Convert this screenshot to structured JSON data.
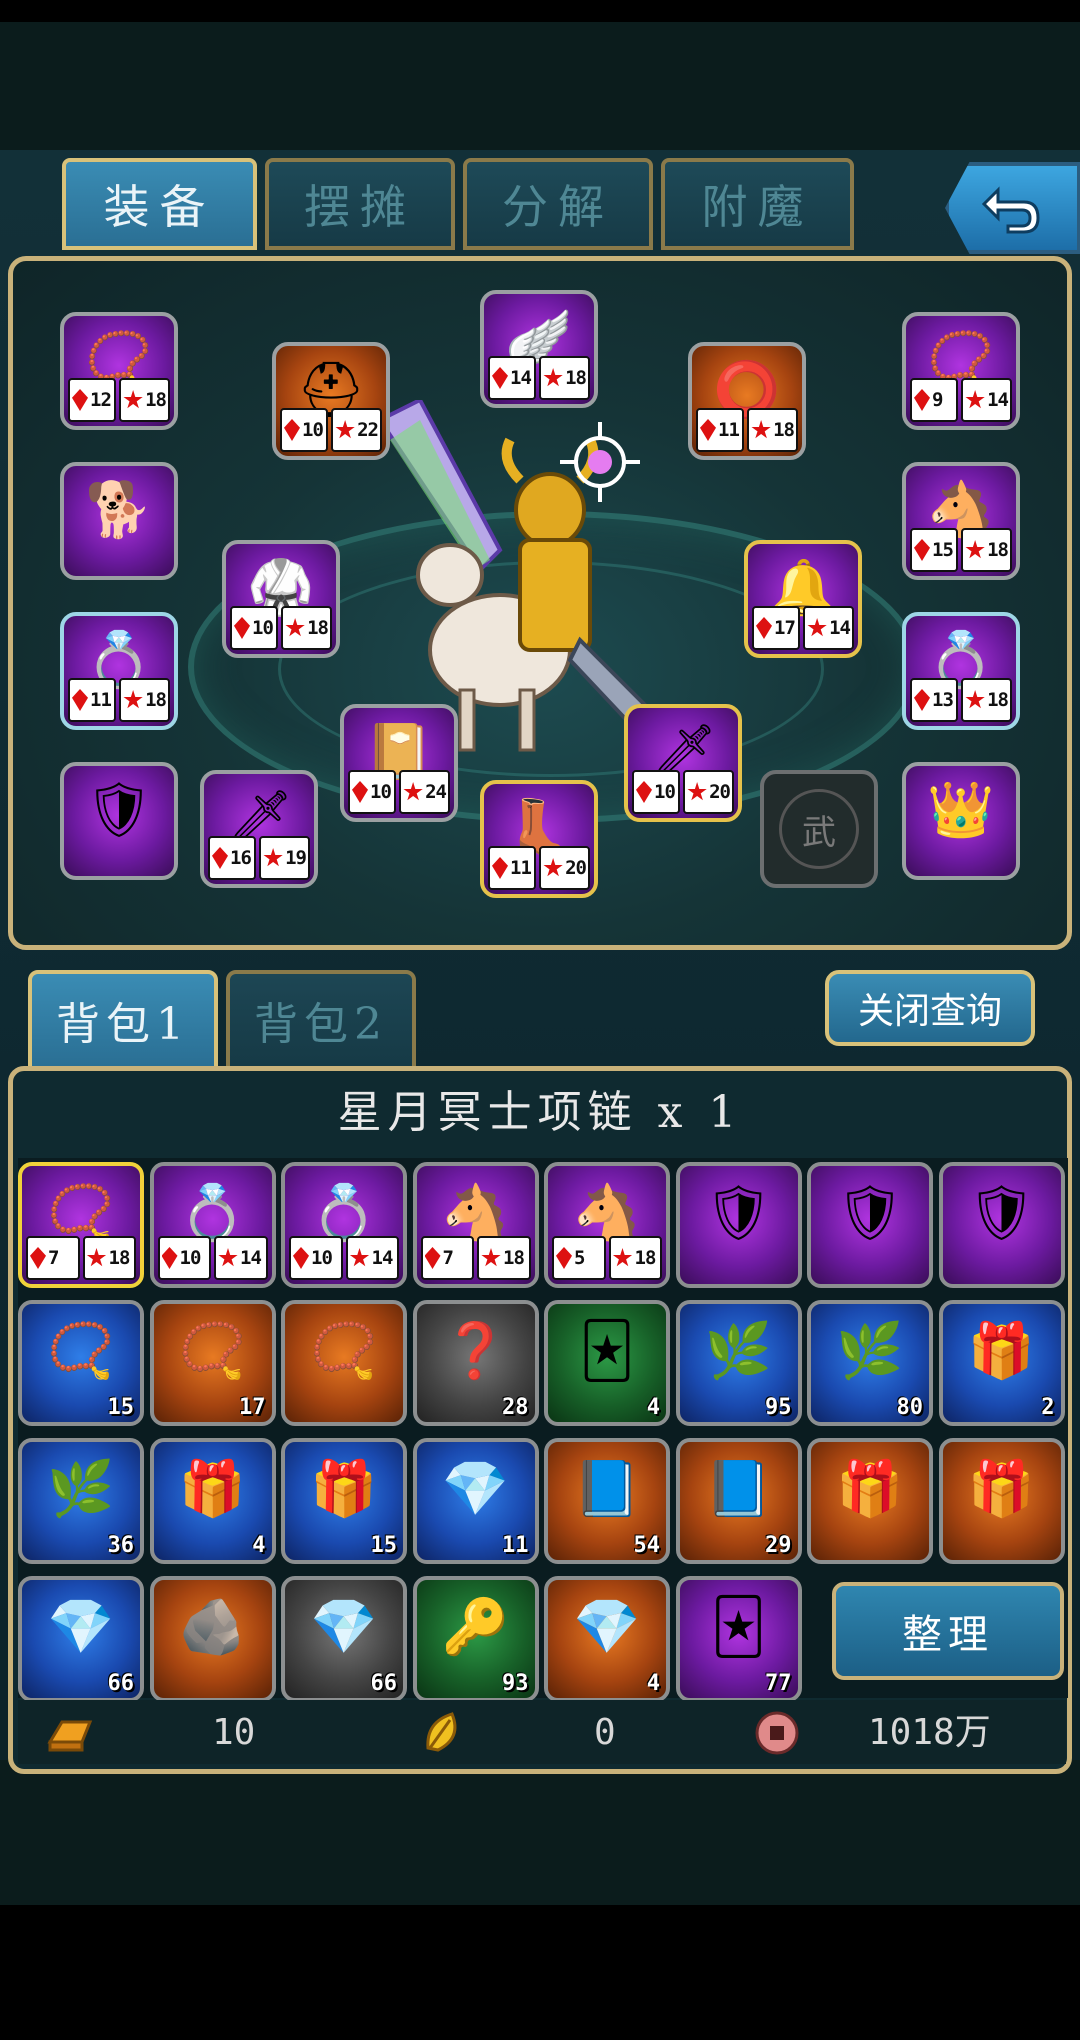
{
  "tabs": [
    {
      "label": "装备",
      "active": true
    },
    {
      "label": "摆摊",
      "active": false
    },
    {
      "label": "分解",
      "active": false
    },
    {
      "label": "附魔",
      "active": false
    }
  ],
  "back_button_icon": "back-arrow-icon",
  "equipment": {
    "slots": [
      {
        "id": "necklace",
        "icon": "necklace-icon",
        "bg": "purple",
        "stats": [
          "12",
          "18"
        ]
      },
      {
        "id": "helmet",
        "icon": "helmet-icon",
        "bg": "orange",
        "stats": [
          "10",
          "22"
        ]
      },
      {
        "id": "wings",
        "icon": "wings-icon",
        "bg": "purple",
        "stats": [
          "14",
          "18"
        ]
      },
      {
        "id": "bracelet",
        "icon": "bracelet-icon",
        "bg": "orange",
        "stats": [
          "11",
          "18"
        ]
      },
      {
        "id": "necklace-2",
        "icon": "necklace-icon",
        "bg": "purple",
        "stats": [
          "9",
          "14"
        ]
      },
      {
        "id": "pet",
        "icon": "dog-icon",
        "bg": "purple",
        "stats": []
      },
      {
        "id": "mount",
        "icon": "horse-icon",
        "bg": "purple",
        "stats": [
          "15",
          "18"
        ]
      },
      {
        "id": "armor",
        "icon": "armor-icon",
        "bg": "purple",
        "stats": [
          "10",
          "18"
        ]
      },
      {
        "id": "belt",
        "icon": "belt-icon",
        "bg": "purple",
        "stats": [
          "17",
          "14"
        ]
      },
      {
        "id": "ring-left",
        "icon": "ring-icon",
        "bg": "purple",
        "stats": [
          "11",
          "18"
        ]
      },
      {
        "id": "ring-right",
        "icon": "ring-icon",
        "bg": "purple",
        "stats": [
          "13",
          "18"
        ]
      },
      {
        "id": "book",
        "icon": "book-icon",
        "bg": "purple",
        "stats": [
          "10",
          "24"
        ]
      },
      {
        "id": "weapon-offhand",
        "icon": "dagger-icon",
        "bg": "purple",
        "stats": [
          "10",
          "20"
        ]
      },
      {
        "id": "shoulder",
        "icon": "shoulder-icon",
        "bg": "purple",
        "stats": []
      },
      {
        "id": "sword",
        "icon": "sword-icon",
        "bg": "purple",
        "stats": [
          "16",
          "19"
        ]
      },
      {
        "id": "boots",
        "icon": "boots-icon",
        "bg": "purple",
        "stats": [
          "11",
          "20"
        ]
      },
      {
        "id": "weapon-empty",
        "icon": "wu-icon",
        "bg": "empty",
        "label": "武",
        "stats": []
      },
      {
        "id": "vip",
        "icon": "vip-crown-icon",
        "bg": "purple",
        "stats": []
      }
    ]
  },
  "bag_tabs": [
    {
      "label": "背包1",
      "active": true
    },
    {
      "label": "背包2",
      "active": false
    }
  ],
  "close_query_label": "关闭查询",
  "selected_item_name": "星月冥士项链 x 1",
  "bag_items": [
    {
      "icon": "necklace-icon",
      "bg": "purple",
      "stats": [
        "7",
        "18"
      ],
      "selected": true
    },
    {
      "icon": "ring-icon",
      "bg": "purple",
      "stats": [
        "10",
        "14"
      ]
    },
    {
      "icon": "ring-icon",
      "bg": "purple",
      "stats": [
        "10",
        "14"
      ]
    },
    {
      "icon": "horse-icon",
      "bg": "purple",
      "stats": [
        "7",
        "18"
      ]
    },
    {
      "icon": "horse-icon",
      "bg": "purple",
      "stats": [
        "5",
        "18"
      ]
    },
    {
      "icon": "shoulder-icon",
      "bg": "purple"
    },
    {
      "icon": "shoulder-icon",
      "bg": "purple"
    },
    {
      "icon": "shoulder-icon",
      "bg": "purple"
    },
    {
      "icon": "necklace-icon",
      "bg": "blue",
      "count": "15"
    },
    {
      "icon": "necklace-icon",
      "bg": "orange",
      "count": "17"
    },
    {
      "icon": "necklace-icon",
      "bg": "orange"
    },
    {
      "icon": "question-icon",
      "bg": "gray",
      "count": "28"
    },
    {
      "icon": "card-icon",
      "bg": "green",
      "count": "4"
    },
    {
      "icon": "herb-icon",
      "bg": "blue",
      "count": "95"
    },
    {
      "icon": "herb-icon",
      "bg": "blue",
      "count": "80"
    },
    {
      "icon": "gift-icon",
      "bg": "blue",
      "count": "2"
    },
    {
      "icon": "herb-icon",
      "bg": "blue",
      "count": "36"
    },
    {
      "icon": "gift-icon",
      "bg": "blue",
      "count": "4"
    },
    {
      "icon": "gift-icon",
      "bg": "blue",
      "count": "15"
    },
    {
      "icon": "gem-icon",
      "bg": "blue",
      "count": "11"
    },
    {
      "icon": "blue-book-icon",
      "bg": "orange",
      "count": "54"
    },
    {
      "icon": "blue-book-icon",
      "bg": "orange",
      "count": "29"
    },
    {
      "icon": "gift-icon",
      "bg": "orange"
    },
    {
      "icon": "gift-icon",
      "bg": "orange"
    },
    {
      "icon": "gem-icon",
      "bg": "blue",
      "count": "66"
    },
    {
      "icon": "ore-icon",
      "bg": "orange"
    },
    {
      "icon": "gem-icon",
      "bg": "gray",
      "count": "66"
    },
    {
      "icon": "key-icon",
      "bg": "green",
      "count": "93"
    },
    {
      "icon": "gem-icon",
      "bg": "orange",
      "count": "4"
    },
    {
      "icon": "card-icon",
      "bg": "purple",
      "count": "77"
    }
  ],
  "sort_button_label": "整理",
  "currencies": [
    {
      "icon": "gold-bar-icon",
      "value": "10"
    },
    {
      "icon": "gold-leaf-icon",
      "value": "0"
    },
    {
      "icon": "copper-coin-icon",
      "value": "1018万"
    }
  ]
}
